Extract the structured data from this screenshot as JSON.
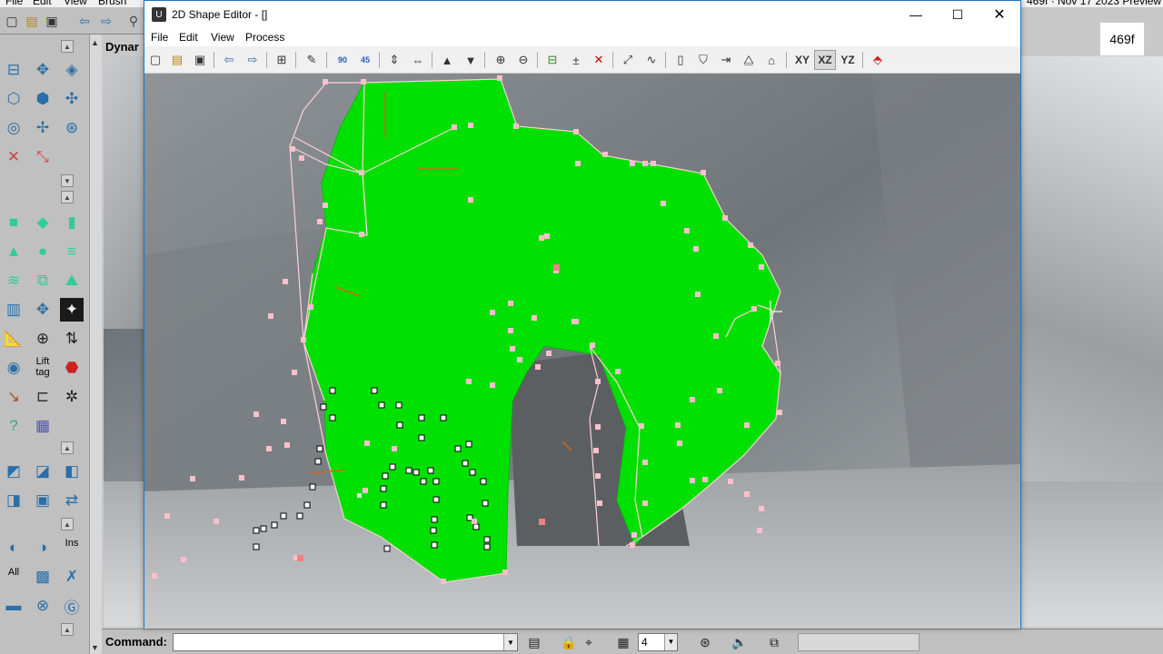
{
  "background_app": {
    "menu": [
      "File",
      "Edit",
      "View",
      "Brush"
    ],
    "title_fragment": "469f  ·  Nov 17 2023 Preview",
    "viewport_label": "Dynar",
    "preview_badge": "469f",
    "lift_tag_label": "Lift\ntag",
    "ins_label": "Ins",
    "all_label": "All"
  },
  "editor_window": {
    "title": "2D Shape Editor - []",
    "menu": {
      "file": "File",
      "edit": "Edit",
      "view": "View",
      "process": "Process"
    },
    "toolbar": {
      "rot90_label": "90",
      "rot45_label": "45",
      "axis_xy": "XY",
      "axis_xz": "XZ",
      "axis_yz": "YZ",
      "active_axis": "XZ"
    },
    "shape_color": "#00e000",
    "edge_color": "#ffd0d8",
    "vertex_color": "#ffc0cc"
  },
  "status_bar": {
    "command_label": "Command:",
    "command_value": "",
    "grid_size": "4"
  }
}
